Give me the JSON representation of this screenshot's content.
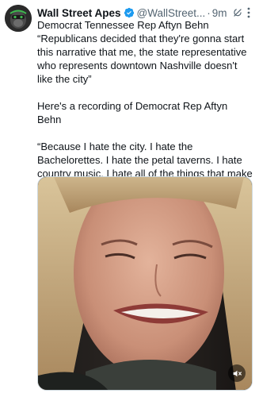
{
  "tweet": {
    "author_name": "Wall Street Apes",
    "handle": "@WallStreet...",
    "separator": "·",
    "time": "9m",
    "paragraphs": [
      "Democrat Tennessee Rep Aftyn Behn",
      "“Republicans decided that they're gonna start this narrative that me, the state representative who represents downtown Nashville doesn't like the city”",
      "Here's a recording of Democrat Rep Aftyn Behn",
      "“Because I hate the city. I hate the Bachelorettes. I hate the petal taverns. I hate country music. I hate all of the things that make Nashville, apparently.”"
    ]
  },
  "icons": {
    "avatar": "ape-avatar",
    "verified": "verified-badge-icon",
    "grok": "grok-icon",
    "more": "more-options-icon",
    "mute": "speaker-muted-icon"
  },
  "colors": {
    "verified_badge": "#1d9bf0",
    "secondary_text": "#536471",
    "primary_text": "#0f1419"
  }
}
